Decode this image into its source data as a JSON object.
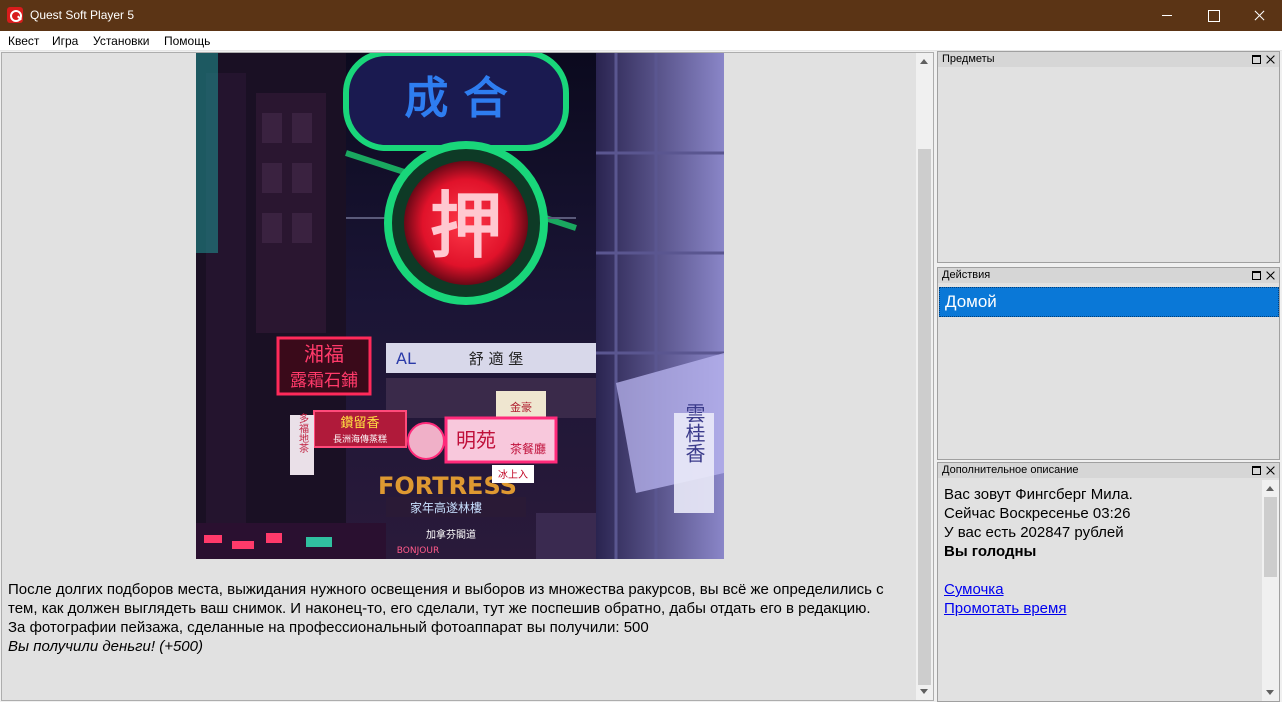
{
  "window": {
    "title": "Quest Soft Player 5"
  },
  "menu": [
    "Квест",
    "Игра",
    "Установки",
    "Помощь"
  ],
  "content": {
    "image_signs": {
      "top_sign": "成 合",
      "round_sign": "押",
      "left_sign": "湘福",
      "left_sign_2": "露霜石鋪",
      "middle_banner": "舒 適 堡",
      "al_sign": "AL",
      "pink_sign": "明苑",
      "pink_sign_2": "茶餐廳",
      "fortress": "FORTRESS",
      "right_vertical": "雲桂香",
      "left_vertical": "多福地茶",
      "small_sign": "金豪",
      "bottom_sign": "加拿芬閣道",
      "bonjour": "BONJOUR",
      "red_sign": "鑽留香",
      "pink_small": "長洲海傳蒸糕",
      "ad_sign": "冰上入",
      "shop": "家年高遂林樓"
    },
    "paragraphs": [
      "После долгих подборов места, выжидания нужного освещения и выборов из множества ракурсов, вы всё же определились с тем, как должен выглядеть ваш снимок. И наконец-то, его сделали, тут же поспешив обратно, дабы отдать его в редакцию.",
      "За фотографии пейзажа, сделанные на профессиональный фотоаппарат вы получили: 500"
    ],
    "money_message": "Вы получили деньги! (+500)"
  },
  "panels": {
    "items": {
      "title": "Предметы"
    },
    "actions": {
      "title": "Действия",
      "list": [
        "Домой"
      ]
    },
    "description": {
      "title": "Дополнительное описание",
      "lines": [
        "Вас зовут Фингсберг Мила.",
        "Сейчас Воскресенье 03:26",
        "У вас есть 202847 рублей"
      ],
      "status": "Вы голодны",
      "links": [
        "Сумочка",
        "Промотать время"
      ]
    }
  },
  "colors": {
    "title_bar": "#5b3415",
    "selected_action": "#0a78d7",
    "link": "#0000ee",
    "panel_bg": "#e1e1e1"
  },
  "icons": {
    "app": "quest-soft-logo-icon",
    "minimize": "minimize-icon",
    "maximize": "maximize-icon",
    "close": "close-icon"
  }
}
